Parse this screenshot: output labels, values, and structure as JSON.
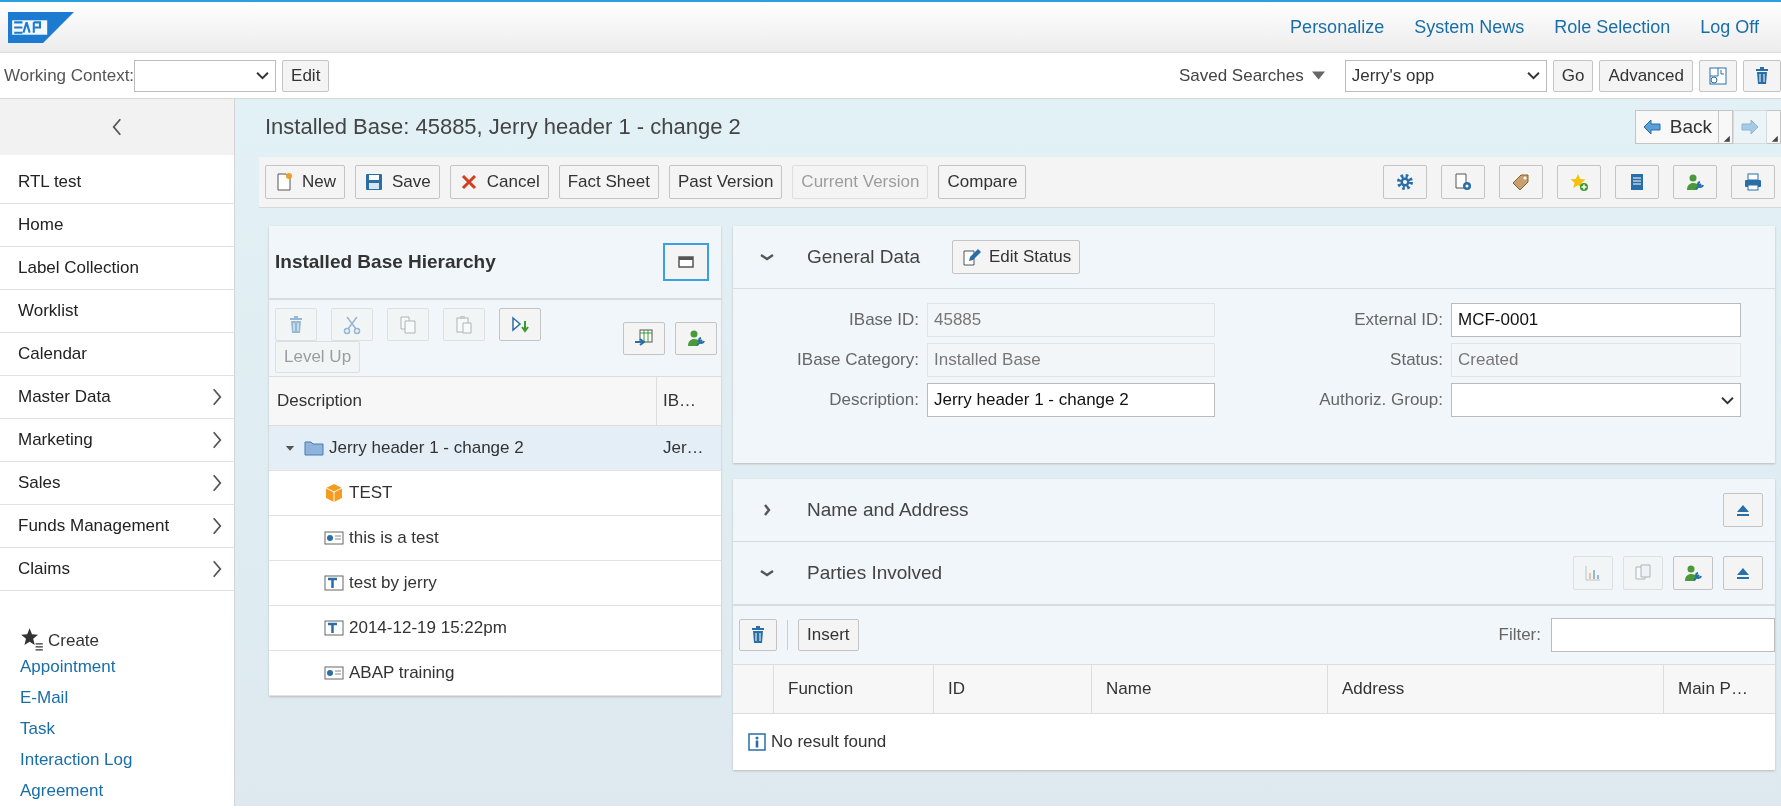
{
  "header": {
    "links": [
      "Personalize",
      "System News",
      "Role Selection",
      "Log Off"
    ]
  },
  "context_bar": {
    "working_context_label": "Working Context:",
    "edit_button": "Edit",
    "saved_searches": "Saved Searches",
    "search_value": "Jerry's opp",
    "buttons": [
      "Go",
      "Advanced"
    ],
    "icon_buttons": [
      {
        "kind": "layout"
      },
      {
        "kind": "trash"
      }
    ]
  },
  "sidebar": {
    "items": [
      {
        "label": "RTL test",
        "has_submenu": false
      },
      {
        "label": "Home",
        "has_submenu": false
      },
      {
        "label": "Label Collection",
        "has_submenu": false
      },
      {
        "label": "Worklist",
        "has_submenu": false
      },
      {
        "label": "Calendar",
        "has_submenu": false
      },
      {
        "label": "Master Data",
        "has_submenu": true
      },
      {
        "label": "Marketing",
        "has_submenu": true
      },
      {
        "label": "Sales",
        "has_submenu": true
      },
      {
        "label": "Funds Management",
        "has_submenu": true
      },
      {
        "label": "Claims",
        "has_submenu": true
      }
    ],
    "create": {
      "title": "Create",
      "links": [
        "Appointment",
        "E-Mail",
        "Task",
        "Interaction Log",
        "Agreement"
      ]
    }
  },
  "page": {
    "title": "Installed Base: 45885, Jerry header 1 - change 2",
    "nav": [
      {
        "kind": "back",
        "label": "Back",
        "disabled": false
      },
      {
        "kind": "forward",
        "disabled": true
      }
    ]
  },
  "toolbar": {
    "buttons": [
      {
        "label": "New",
        "kind": "new",
        "disabled": false
      },
      {
        "label": "Save",
        "kind": "save",
        "disabled": false
      },
      {
        "label": "Cancel",
        "kind": "cancel",
        "disabled": false
      },
      {
        "label": "Fact Sheet",
        "disabled": false
      },
      {
        "label": "Past Version",
        "disabled": false
      },
      {
        "label": "Current Version",
        "disabled": true
      },
      {
        "label": "Compare",
        "disabled": false
      }
    ],
    "icon_buttons": [
      {
        "kind": "gear"
      },
      {
        "kind": "doc-gear"
      },
      {
        "kind": "tag"
      },
      {
        "kind": "star-add"
      },
      {
        "kind": "list"
      },
      {
        "kind": "user-wrench"
      },
      {
        "kind": "print"
      }
    ]
  },
  "hierarchy": {
    "title": "Installed Base Hierarchy",
    "tools": [
      {
        "kind": "trash",
        "disabled": true
      },
      {
        "kind": "cut",
        "disabled": true
      },
      {
        "kind": "copy",
        "disabled": true
      },
      {
        "kind": "paste",
        "disabled": true
      },
      {
        "kind": "expand",
        "disabled": false
      }
    ],
    "level_up": {
      "label": "Level Up",
      "disabled": true
    },
    "right_tools": [
      {
        "kind": "table-export",
        "disabled": false
      },
      {
        "kind": "user-wrench",
        "disabled": false
      }
    ],
    "columns": [
      "Description",
      "IB…"
    ],
    "tree": [
      {
        "label": "Jerry header 1 - change 2",
        "ib": "Jer…",
        "kind": "folder",
        "expanded": true,
        "selected": true,
        "children": [
          {
            "label": "TEST",
            "kind": "cube",
            "selected": false
          },
          {
            "label": "this is a test",
            "kind": "card",
            "selected": false
          },
          {
            "label": "test by jerry",
            "kind": "text",
            "selected": false
          },
          {
            "label": "2014-12-19 15:22pm",
            "kind": "text",
            "selected": false
          },
          {
            "label": "ABAP training",
            "kind": "card",
            "selected": false
          }
        ]
      }
    ]
  },
  "general_data": {
    "title": "General Data",
    "expanded": true,
    "action": "Edit Status",
    "fields": [
      {
        "label": "IBase ID:",
        "value": "45885",
        "kind": "input",
        "disabled": true
      },
      {
        "label": "External ID:",
        "value": "MCF-0001",
        "kind": "input",
        "disabled": false
      },
      {
        "label": "IBase Category:",
        "value": "Installed Base",
        "kind": "input",
        "disabled": true
      },
      {
        "label": "Status:",
        "value": "Created",
        "kind": "input",
        "disabled": true
      },
      {
        "label": "Description:",
        "value": "Jerry header 1 - change 2",
        "kind": "input",
        "disabled": false
      },
      {
        "label": "Authoriz. Group:",
        "kind": "select",
        "disabled": false
      }
    ]
  },
  "name_address": {
    "title": "Name and Address",
    "expanded": false,
    "tools": [
      {
        "kind": "collapse-up",
        "disabled": false
      }
    ]
  },
  "parties": {
    "title": "Parties Involved",
    "expanded": true,
    "tools": [
      {
        "kind": "chart",
        "disabled": true
      },
      {
        "kind": "copy-doc",
        "disabled": true
      },
      {
        "kind": "user-wrench",
        "disabled": false
      },
      {
        "kind": "collapse-up",
        "disabled": false
      }
    ],
    "insert": "Insert",
    "filter_label": "Filter:",
    "columns": [
      "Function",
      "ID",
      "Name",
      "Address",
      "Main P…"
    ],
    "empty_text": "No result found"
  }
}
